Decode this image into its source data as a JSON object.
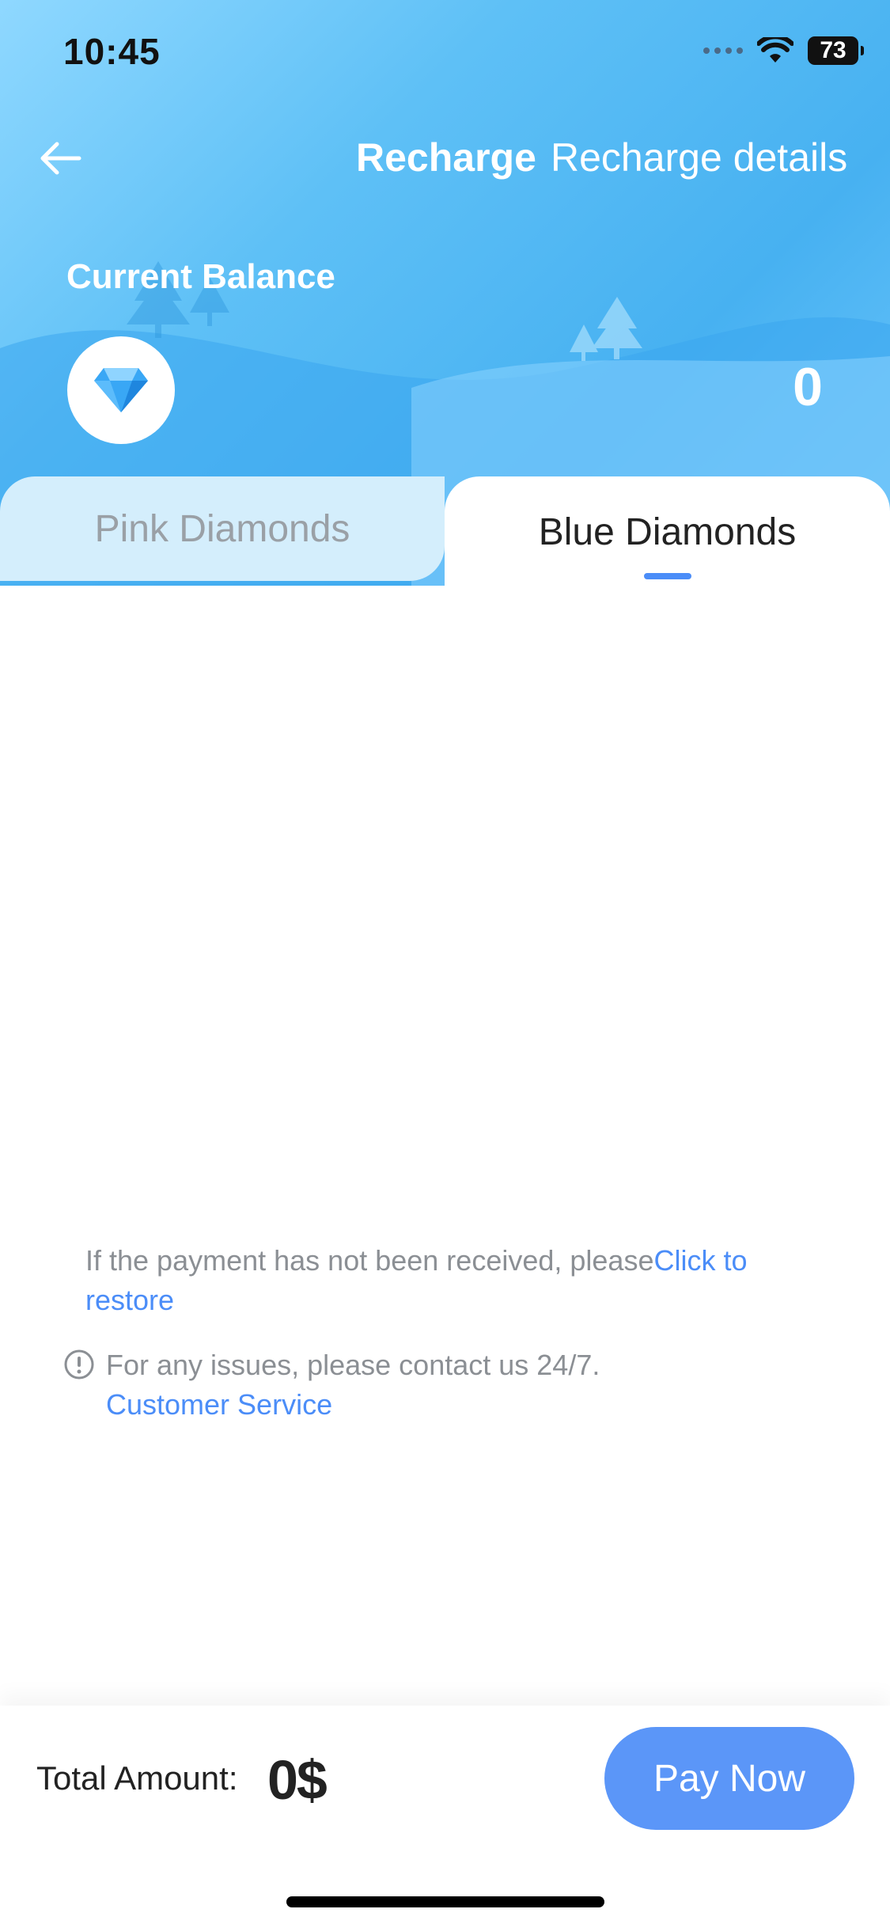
{
  "status_bar": {
    "time": "10:45",
    "battery": "73"
  },
  "nav": {
    "title": "Recharge",
    "details_link": "Recharge details"
  },
  "balance": {
    "label": "Current Balance",
    "value": "0"
  },
  "tabs": [
    {
      "label": "Pink Diamonds",
      "active": false
    },
    {
      "label": "Blue Diamonds",
      "active": true
    }
  ],
  "restore": {
    "text": "If the payment has not been received, please",
    "link": "Click to restore"
  },
  "notice": {
    "text": "For any issues, please contact us 24/7.",
    "link": "Customer Service"
  },
  "footer": {
    "total_label": "Total Amount:",
    "total_value": "0$",
    "pay_label": "Pay Now"
  },
  "colors": {
    "accent": "#5b96f8",
    "header": "#47b1f1",
    "link": "#4b8df8"
  }
}
